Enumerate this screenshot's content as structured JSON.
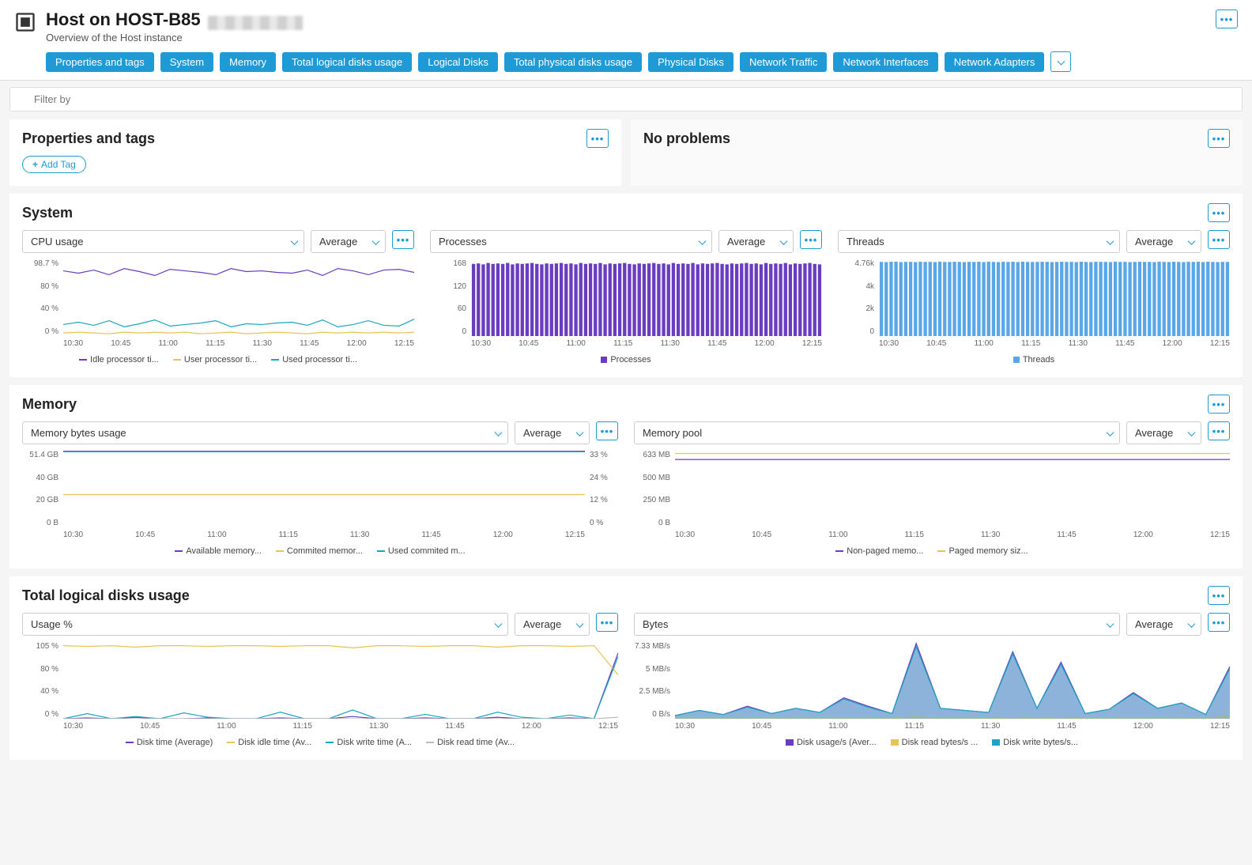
{
  "header": {
    "title_prefix": "Host on HOST-B85",
    "subtitle": "Overview of the Host instance"
  },
  "nav_pills": [
    "Properties and tags",
    "System",
    "Memory",
    "Total logical disks usage",
    "Logical Disks",
    "Total physical disks usage",
    "Physical Disks",
    "Network Traffic",
    "Network Interfaces",
    "Network Adapters"
  ],
  "filter": {
    "placeholder": "Filter by"
  },
  "sections": {
    "properties": {
      "title": "Properties and tags",
      "add_tag_label": "Add Tag"
    },
    "problems": {
      "title": "No problems"
    },
    "system": {
      "title": "System"
    },
    "memory": {
      "title": "Memory"
    },
    "disks": {
      "title": "Total logical disks usage"
    }
  },
  "aggregation_default": "Average",
  "x_labels": [
    "10:30",
    "10:45",
    "11:00",
    "11:15",
    "11:30",
    "11:45",
    "12:00",
    "12:15"
  ],
  "chart_data": [
    {
      "id": "cpu_usage",
      "type": "line",
      "title": "CPU usage",
      "ylim": [
        0,
        100
      ],
      "y_ticks": [
        "98.7 %",
        "80 %",
        "40 %",
        "0 %"
      ],
      "series": [
        {
          "name": "Idle processor ti...",
          "color": "#6a3cbf",
          "values": [
            85,
            82,
            86,
            80,
            88,
            84,
            79,
            87,
            85,
            83,
            80,
            88,
            84,
            85,
            83,
            82,
            86,
            79,
            88,
            85,
            80,
            86,
            87,
            83
          ]
        },
        {
          "name": "User processor ti...",
          "color": "#e6c653",
          "values": [
            4,
            5,
            4,
            3,
            5,
            4,
            5,
            4,
            5,
            3,
            4,
            5,
            3,
            4,
            5,
            4,
            3,
            5,
            4,
            5,
            4,
            5,
            4,
            5
          ]
        },
        {
          "name": "Used processor ti...",
          "color": "#1aa6c1",
          "values": [
            15,
            18,
            14,
            20,
            12,
            16,
            21,
            13,
            15,
            17,
            20,
            12,
            16,
            15,
            17,
            18,
            14,
            21,
            12,
            15,
            20,
            14,
            13,
            22
          ]
        }
      ]
    },
    {
      "id": "processes",
      "type": "bar",
      "title": "Processes",
      "ylim": [
        0,
        168
      ],
      "y_ticks": [
        "168",
        "120",
        "60",
        "0"
      ],
      "series": [
        {
          "name": "Processes",
          "color": "#6a3cbf",
          "values": [
            158,
            159,
            157,
            160,
            158,
            159,
            158,
            160,
            157,
            159,
            158,
            159,
            160,
            158,
            157,
            159,
            158,
            159,
            160,
            158,
            159,
            157,
            160,
            158,
            159,
            158,
            160,
            157,
            159,
            158,
            159,
            160,
            158,
            157,
            159,
            158,
            159,
            160,
            158,
            159,
            157,
            160,
            158,
            159,
            158,
            160,
            157,
            159,
            158,
            159,
            160,
            158,
            157,
            159,
            158,
            159,
            160,
            158,
            159,
            157,
            160,
            158,
            159,
            158,
            160,
            157,
            159,
            158,
            159,
            160,
            158,
            157
          ]
        }
      ]
    },
    {
      "id": "threads",
      "type": "bar",
      "title": "Threads",
      "ylim": [
        0,
        4760
      ],
      "y_ticks": [
        "4.76k",
        "4k",
        "2k",
        "0"
      ],
      "series": [
        {
          "name": "Threads",
          "color": "#5aa6e6",
          "values": [
            4600,
            4590,
            4610,
            4615,
            4590,
            4600,
            4605,
            4590,
            4610,
            4600,
            4605,
            4590,
            4615,
            4600,
            4595,
            4610,
            4600,
            4590,
            4605,
            4600,
            4610,
            4590,
            4615,
            4600,
            4590,
            4605,
            4600,
            4610,
            4590,
            4615,
            4600,
            4595,
            4600,
            4610,
            4605,
            4590,
            4600,
            4610,
            4600,
            4605,
            4590,
            4615,
            4600,
            4590,
            4610,
            4605,
            4600,
            4590,
            4615,
            4600,
            4605,
            4590,
            4600,
            4610,
            4600,
            4605,
            4590,
            4615,
            4600,
            4595,
            4610,
            4600,
            4590,
            4605,
            4600,
            4610,
            4590,
            4615,
            4600,
            4590,
            4605,
            4600
          ]
        }
      ]
    },
    {
      "id": "memory_bytes",
      "type": "line",
      "title": "Memory bytes usage",
      "ylim_left": [
        0,
        51.4
      ],
      "ylim_right": [
        0,
        33
      ],
      "y_ticks_left": [
        "51.4 GB",
        "40 GB",
        "20 GB",
        "0 B"
      ],
      "y_ticks_right": [
        "33 %",
        "24 %",
        "12 %",
        "0 %"
      ],
      "series": [
        {
          "name": "Available memory...",
          "color": "#6a3cbf",
          "axis": "left",
          "values": [
            51,
            51,
            51,
            51,
            51,
            51,
            51,
            51,
            51,
            51,
            51,
            51
          ]
        },
        {
          "name": "Commited memor...",
          "color": "#e6c653",
          "axis": "left",
          "values": [
            22,
            22,
            22,
            22,
            22,
            22,
            22,
            22,
            22,
            22,
            22,
            22
          ]
        },
        {
          "name": "Used commited m...",
          "color": "#1aa6c1",
          "axis": "right",
          "values": [
            32.5,
            32.5,
            32.5,
            32.5,
            32.5,
            32.5,
            32.5,
            32.5,
            32.5,
            32.5,
            32.5,
            32.5
          ]
        }
      ]
    },
    {
      "id": "memory_pool",
      "type": "line",
      "title": "Memory pool",
      "ylim": [
        0,
        633
      ],
      "y_ticks": [
        "633 MB",
        "500 MB",
        "250 MB",
        "0 B"
      ],
      "series": [
        {
          "name": "Non-paged memo...",
          "color": "#6a3cbf",
          "values": [
            560,
            560,
            560,
            560,
            560,
            560,
            560,
            560,
            560,
            560,
            560,
            560
          ]
        },
        {
          "name": "Paged memory siz...",
          "color": "#e6c653",
          "values": [
            610,
            610,
            610,
            610,
            610,
            610,
            610,
            610,
            610,
            610,
            610,
            610
          ]
        }
      ]
    },
    {
      "id": "disk_usage_pct",
      "type": "line",
      "title": "Usage %",
      "ylim": [
        0,
        105
      ],
      "y_ticks": [
        "105 %",
        "80 %",
        "40 %",
        "0 %"
      ],
      "series": [
        {
          "name": "Disk time (Average)",
          "color": "#6a3cbf",
          "values": [
            0,
            1,
            0,
            2,
            0,
            0,
            1,
            0,
            0,
            1,
            0,
            0,
            3,
            0,
            0,
            1,
            0,
            0,
            2,
            0,
            0,
            1,
            0,
            90
          ]
        },
        {
          "name": "Disk idle time (Av...",
          "color": "#e6c653",
          "values": [
            100,
            99,
            100,
            98,
            100,
            100,
            99,
            100,
            100,
            99,
            100,
            100,
            97,
            100,
            100,
            99,
            100,
            100,
            98,
            100,
            100,
            99,
            100,
            60
          ]
        },
        {
          "name": "Disk write time (A...",
          "color": "#1aa6c1",
          "values": [
            0,
            7,
            0,
            3,
            0,
            8,
            2,
            0,
            0,
            9,
            0,
            0,
            12,
            0,
            0,
            6,
            0,
            0,
            9,
            2,
            0,
            5,
            0,
            85
          ]
        },
        {
          "name": "Disk read time (Av...",
          "color": "#bbbbbb",
          "values": [
            0,
            0,
            0,
            0,
            0,
            0,
            0,
            0,
            0,
            0,
            0,
            0,
            0,
            0,
            0,
            0,
            0,
            0,
            0,
            0,
            0,
            0,
            0,
            2
          ]
        }
      ]
    },
    {
      "id": "disk_bytes",
      "type": "area",
      "title": "Bytes",
      "ylim": [
        0,
        7.33
      ],
      "y_ticks": [
        "7.33 MB/s",
        "5 MB/s",
        "2.5 MB/s",
        "0 B/s"
      ],
      "series": [
        {
          "name": "Disk usage/s (Aver...",
          "color": "#6a3cbf",
          "values": [
            0.3,
            0.8,
            0.4,
            1.2,
            0.5,
            1.0,
            0.6,
            2.0,
            1.2,
            0.5,
            7.2,
            1.0,
            0.8,
            0.6,
            6.4,
            1.0,
            5.4,
            0.5,
            0.9,
            2.5,
            1.0,
            1.5,
            0.4,
            5.0
          ]
        },
        {
          "name": "Disk read bytes/s ...",
          "color": "#e6c653",
          "values": [
            0,
            0,
            0,
            0,
            0,
            0,
            0,
            0,
            0,
            0,
            0.2,
            0,
            0,
            0,
            0.1,
            0,
            0.1,
            0,
            0,
            0,
            0,
            0,
            0,
            0.3
          ]
        },
        {
          "name": "Disk write bytes/s...",
          "color": "#1aa6c1",
          "values": [
            0.3,
            0.8,
            0.4,
            1.1,
            0.5,
            1.0,
            0.6,
            1.9,
            1.1,
            0.5,
            6.9,
            1.0,
            0.8,
            0.6,
            6.2,
            1.0,
            5.2,
            0.5,
            0.9,
            2.4,
            1.0,
            1.5,
            0.4,
            4.8
          ]
        }
      ]
    }
  ]
}
